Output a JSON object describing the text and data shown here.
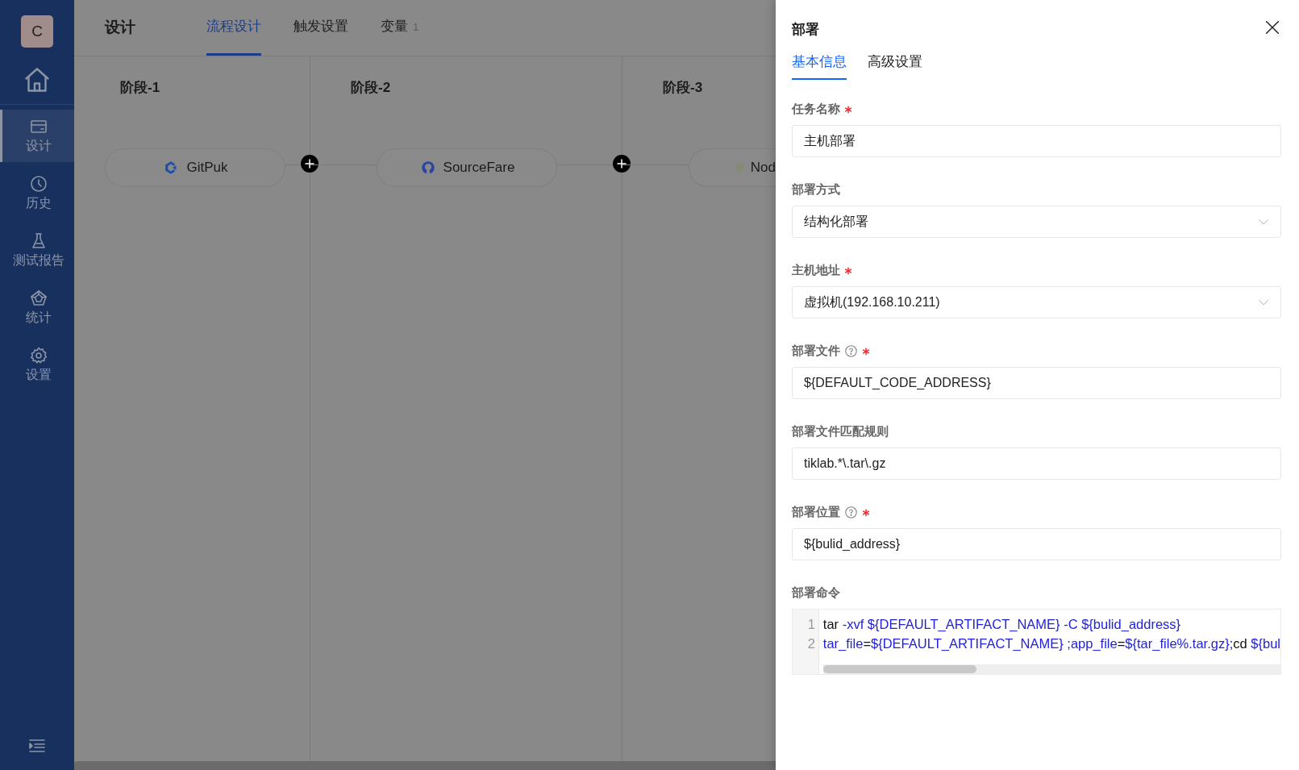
{
  "sidebar": {
    "avatar": "C",
    "items": [
      {
        "label": "设计",
        "selected": true
      },
      {
        "label": "历史",
        "selected": false
      },
      {
        "label": "测试报告",
        "selected": false
      },
      {
        "label": "统计",
        "selected": false
      },
      {
        "label": "设置",
        "selected": false
      }
    ]
  },
  "header": {
    "title": "设计",
    "tabs": [
      {
        "label": "流程设计",
        "selected": true
      },
      {
        "label": "触发设置",
        "selected": false
      },
      {
        "label": "变量",
        "count": "1",
        "selected": false
      }
    ]
  },
  "stages": [
    {
      "title": "阶段-1",
      "task": {
        "name": "GitPuk"
      }
    },
    {
      "title": "阶段-2",
      "task": {
        "name": "SourceFare"
      }
    },
    {
      "title": "阶段-3",
      "task": {
        "name": "Nod"
      }
    }
  ],
  "drawer": {
    "title": "部署",
    "tabs": [
      {
        "label": "基本信息",
        "selected": true
      },
      {
        "label": "高级设置",
        "selected": false
      }
    ],
    "fields": [
      {
        "label": "任务名称",
        "kind": "input",
        "value": "主机部署",
        "required": true,
        "help": false
      },
      {
        "label": "部署方式",
        "kind": "select",
        "value": "结构化部署",
        "required": false,
        "help": false
      },
      {
        "label": "主机地址",
        "kind": "select",
        "value": "虚拟机(192.168.10.211)",
        "required": true,
        "help": false
      },
      {
        "label": "部署文件",
        "kind": "input",
        "value": "${DEFAULT_CODE_ADDRESS}",
        "required": true,
        "help": true
      },
      {
        "label": "部署文件匹配规则",
        "kind": "input",
        "value": "tiklab.*\\.tar\\.gz",
        "required": false,
        "help": false
      },
      {
        "label": "部署位置",
        "kind": "input",
        "value": "${bulid_address}",
        "required": true,
        "help": true
      }
    ],
    "command": {
      "label": "部署命令",
      "lines": [
        {
          "number": "1",
          "tokens": [
            {
              "kind": "plain",
              "text": "tar"
            },
            {
              "kind": "variable",
              "text": " -xvf  ${DEFAULT_ARTIFACT_NAME} -C ${bulid_address}"
            }
          ]
        },
        {
          "number": "2",
          "tokens": [
            {
              "kind": "variable",
              "text": "tar_file"
            },
            {
              "kind": "plain",
              "text": "="
            },
            {
              "kind": "variable",
              "text": "${DEFAULT_ARTIFACT_NAME} ;app_file"
            },
            {
              "kind": "plain",
              "text": "="
            },
            {
              "kind": "variable",
              "text": "${tar_file%.tar.gz};"
            },
            {
              "kind": "plain",
              "text": "cd "
            },
            {
              "kind": "variable",
              "text": "${bul"
            }
          ]
        }
      ]
    }
  }
}
